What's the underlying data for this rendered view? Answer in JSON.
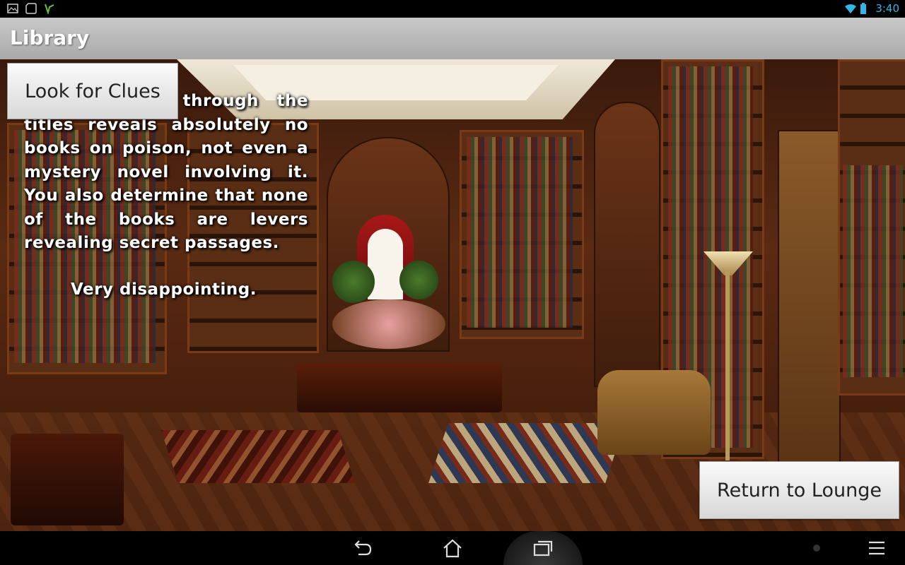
{
  "status_bar": {
    "time": "3:40",
    "left_icons": [
      "gallery-icon",
      "screenshot-icon",
      "app-notification-icon"
    ],
    "right_icons": [
      "wifi-icon",
      "battery-icon"
    ],
    "accent_color": "#33b5e5"
  },
  "action_bar": {
    "title": "Library"
  },
  "main": {
    "look_button_label": "Look for Clues",
    "story_paragraph": "A search through the titles reveals absolutely no books on poison, not even a mystery novel involving it. You also determine that none of the books are levers revealing secret passages.",
    "story_closing": "Very disappointing.",
    "return_button_label": "Return to Lounge"
  },
  "nav_bar": {
    "buttons": [
      "back-icon",
      "home-icon",
      "recent-apps-icon"
    ],
    "right_icons": [
      "dot-icon",
      "menu-icon"
    ]
  }
}
